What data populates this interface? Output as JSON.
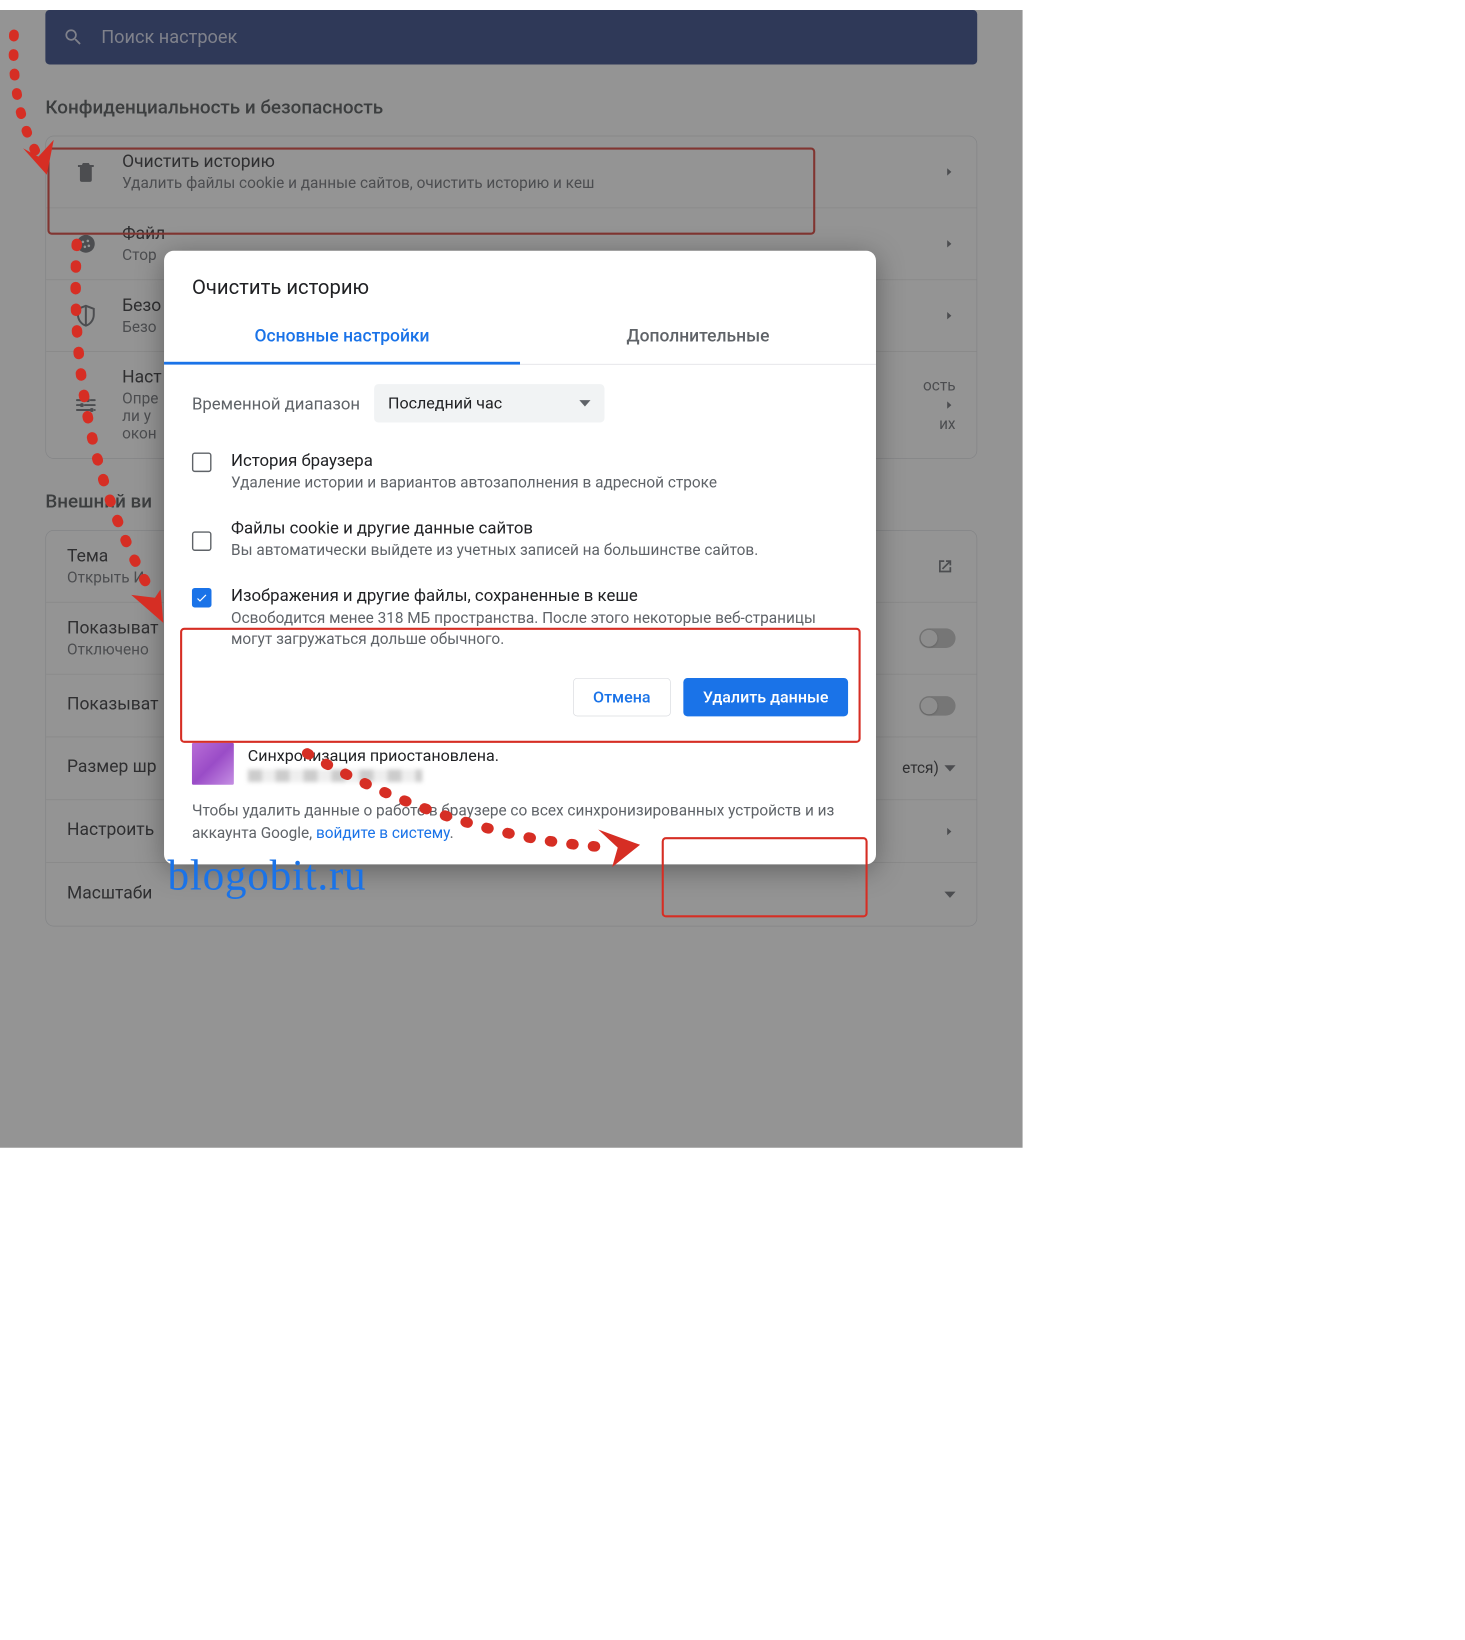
{
  "search": {
    "placeholder": "Поиск настроек"
  },
  "sections": {
    "privacy": {
      "title": "Конфиденциальность и безопасность",
      "items": [
        {
          "title": "Очистить историю",
          "sub": "Удалить файлы cookie и данные сайтов, очистить историю и кеш"
        },
        {
          "title": "Файл",
          "sub": "Стор"
        },
        {
          "title": "Безо",
          "sub": "Безо"
        },
        {
          "title": "Наст",
          "sub": "Опре\nли у\nокон"
        }
      ]
    },
    "appearance": {
      "title": "Внешний ви",
      "items": [
        {
          "title": "Тема",
          "sub": "Открыть И",
          "trailing": "external"
        },
        {
          "title": "Показыват",
          "sub": "Отключено",
          "trailing": "toggle"
        },
        {
          "title": "Показыват",
          "sub": "",
          "trailing": "toggle"
        },
        {
          "title": "Размер шр",
          "sub": "",
          "trailing_text": "ется)",
          "trailing": "dropdown"
        },
        {
          "title": "Настроить",
          "sub": "",
          "trailing": "chevron"
        },
        {
          "title": "Масштаби",
          "sub": "",
          "trailing": "dropdown"
        }
      ]
    }
  },
  "dialog": {
    "title": "Очистить историю",
    "tabs": {
      "basic": "Основные настройки",
      "advanced": "Дополнительные"
    },
    "range_label": "Временной диапазон",
    "range_value": "Последний час",
    "checks": [
      {
        "title": "История браузера",
        "sub": "Удаление истории и вариантов автозаполнения в адресной строке",
        "checked": false
      },
      {
        "title": "Файлы cookie и другие данные сайтов",
        "sub": "Вы автоматически выйдете из учетных записей на большинстве сайтов.",
        "checked": false
      },
      {
        "title": "Изображения и другие файлы, сохраненные в кеше",
        "sub": "Освободится менее 318 МБ пространства. После этого некоторые веб-страницы могут загружаться дольше обычного.",
        "checked": true
      }
    ],
    "cancel": "Отмена",
    "confirm": "Удалить данные",
    "sync_title": "Синхронизация приостановлена.",
    "footnote_a": "Чтобы удалить данные о работе в браузере со всех синхронизированных устройств и из аккаунта Google, ",
    "footnote_link": "войдите в систему",
    "footnote_b": "."
  },
  "watermark": "blogobit.ru"
}
